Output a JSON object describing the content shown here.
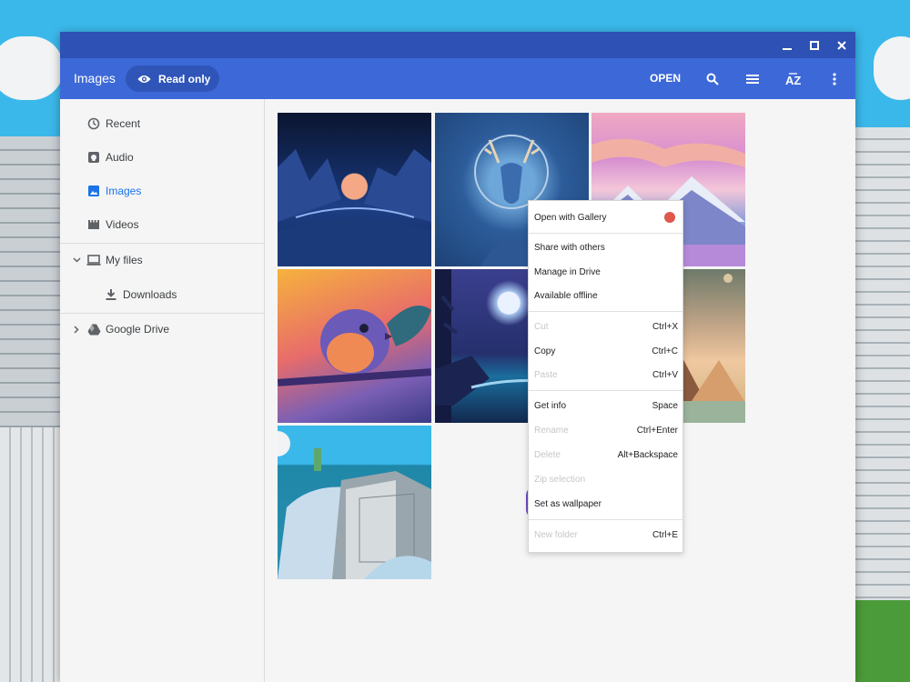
{
  "window": {
    "controls": {
      "minimize": "minimize-icon",
      "maximize": "maximize-icon",
      "close": "close-icon"
    }
  },
  "toolbar": {
    "breadcrumb": "Images",
    "read_only_label": "Read only",
    "open_label": "OPEN",
    "icons": [
      "eye-icon",
      "search-icon",
      "list-view-icon",
      "sort-az-icon",
      "more-vert-icon"
    ]
  },
  "sidebar": {
    "items": [
      {
        "label": "Recent",
        "icon": "clock-icon"
      },
      {
        "label": "Audio",
        "icon": "audio-icon"
      },
      {
        "label": "Images",
        "icon": "image-icon",
        "active": true
      },
      {
        "label": "Videos",
        "icon": "video-icon"
      },
      {
        "label": "My files",
        "icon": "laptop-icon"
      },
      {
        "label": "Downloads",
        "icon": "download-icon"
      },
      {
        "label": "Google Drive",
        "icon": "drive-icon"
      }
    ],
    "colors": {
      "active": "#1a73e8",
      "text": "#3c4043"
    }
  },
  "files": {
    "thumbnails": [
      "night-lake-landscape",
      "blue-deer-illustration",
      "pink-mountain-sunset",
      "bird-on-branch",
      "moonlit-shore",
      "desert-pyramids-moon",
      "isometric-city"
    ]
  },
  "context_menu": {
    "items": [
      {
        "label": "Open with Gallery",
        "shortcut": "",
        "disabled": false
      },
      {
        "label": "Share with others",
        "shortcut": "",
        "disabled": false
      },
      {
        "label": "Manage in Drive",
        "shortcut": "",
        "disabled": false
      },
      {
        "label": "Available offline",
        "shortcut": "",
        "disabled": false
      },
      {
        "label": "Cut",
        "shortcut": "Ctrl+X",
        "disabled": true
      },
      {
        "label": "Copy",
        "shortcut": "Ctrl+C",
        "disabled": false
      },
      {
        "label": "Paste",
        "shortcut": "Ctrl+V",
        "disabled": true
      },
      {
        "label": "Get info",
        "shortcut": "Space",
        "disabled": false
      },
      {
        "label": "Rename",
        "shortcut": "Ctrl+Enter",
        "disabled": true
      },
      {
        "label": "Delete",
        "shortcut": "Alt+Backspace",
        "disabled": true
      },
      {
        "label": "Zip selection",
        "shortcut": "",
        "disabled": true
      },
      {
        "label": "Set as wallpaper",
        "shortcut": "",
        "disabled": false,
        "highlighted": true
      },
      {
        "label": "New folder",
        "shortcut": "Ctrl+E",
        "disabled": true
      }
    ],
    "highlight_color": "#6e4cc4"
  },
  "colors": {
    "titlebar": "#2d51b4",
    "toolbar": "#3d68d8",
    "read_only_pill": "#2f55b8"
  }
}
